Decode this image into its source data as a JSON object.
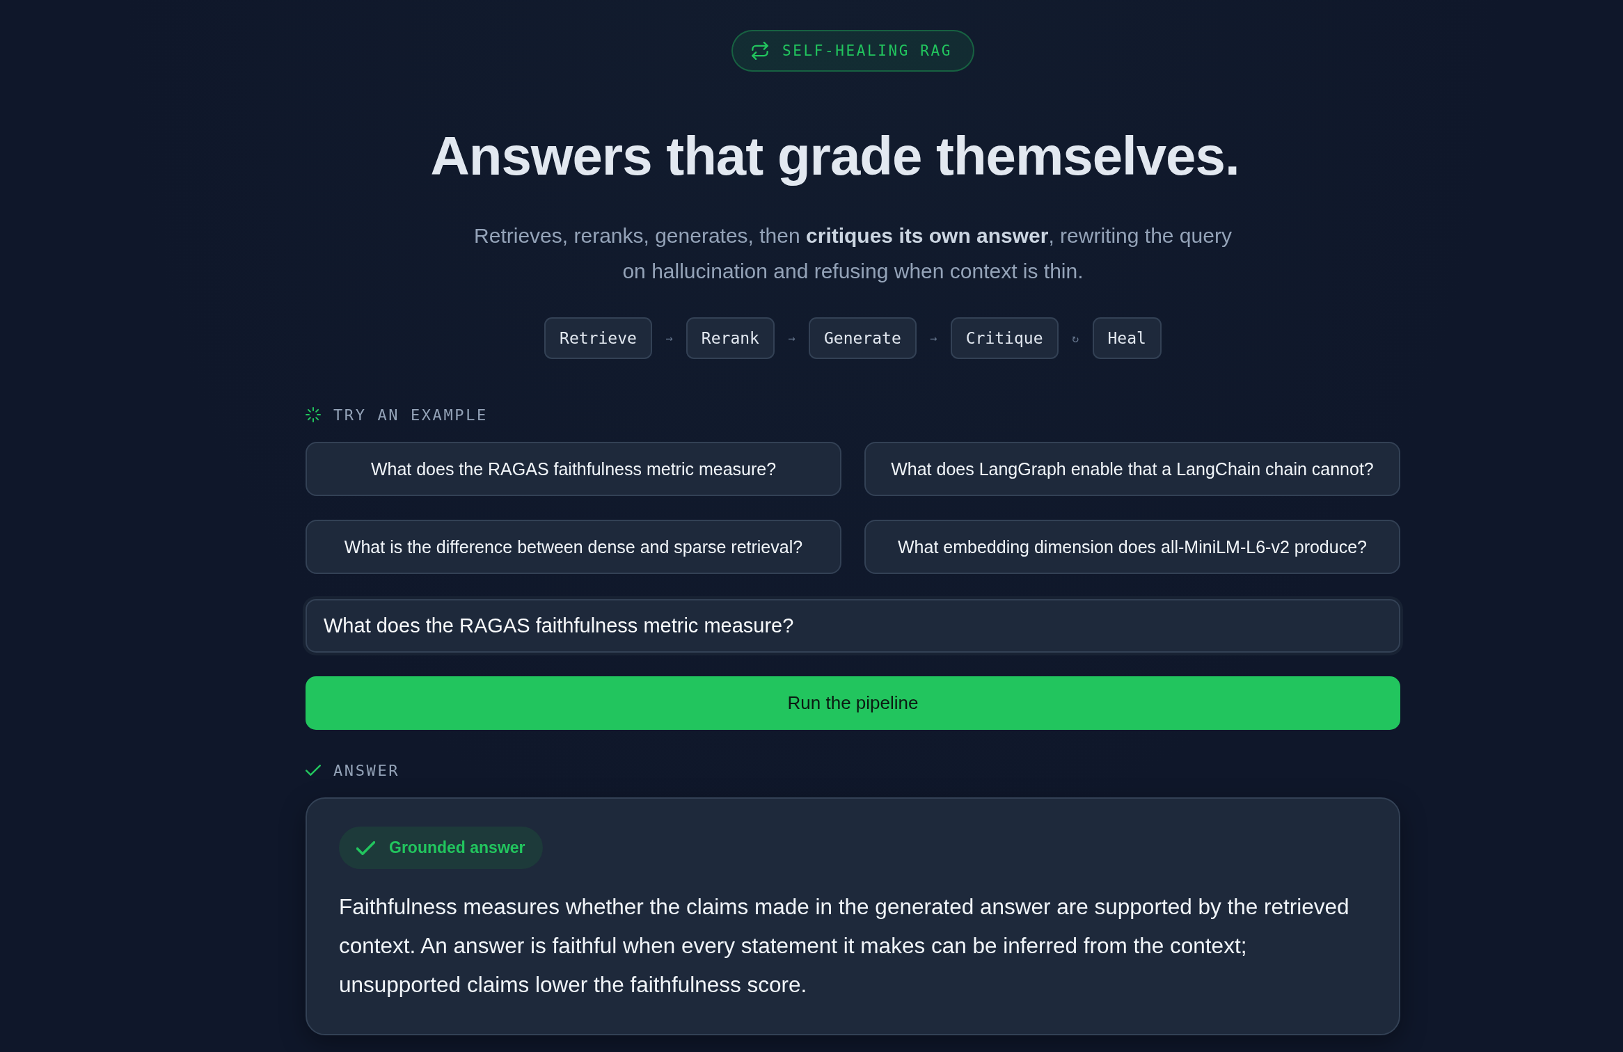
{
  "badge": {
    "label": "SELF-HEALING RAG"
  },
  "hero": {
    "title": "Answers that grade themselves.",
    "subtitle": "Retrieves, reranks, generates, then **critiques its own answer**, rewriting the query on hallucination and refusing when context is thin."
  },
  "pipeline": {
    "steps": [
      {
        "label": "Retrieve",
        "next": "→"
      },
      {
        "label": "Rerank",
        "next": "→"
      },
      {
        "label": "Generate",
        "next": "→"
      },
      {
        "label": "Critique",
        "next": "↻"
      },
      {
        "label": "Heal"
      }
    ]
  },
  "examples": {
    "heading": "TRY AN EXAMPLE",
    "items": [
      "What does the RAGAS faithfulness metric measure?",
      "What does LangGraph enable that a LangChain chain cannot?",
      "What is the difference between dense and sparse retrieval?",
      "What embedding dimension does all-MiniLM-L6-v2 produce?"
    ]
  },
  "query": {
    "value": "What does the RAGAS faithfulness metric measure?"
  },
  "run_button": {
    "label": "Run the pipeline"
  },
  "answer": {
    "heading": "ANSWER",
    "status": {
      "kind": "grounded",
      "label": "Grounded answer"
    },
    "text": "Faithfulness measures whether the claims made in the generated answer are supported by the retrieved context. An answer is faithful when every statement it makes can be inferred from the context; unsupported claims lower the faithfulness score."
  }
}
